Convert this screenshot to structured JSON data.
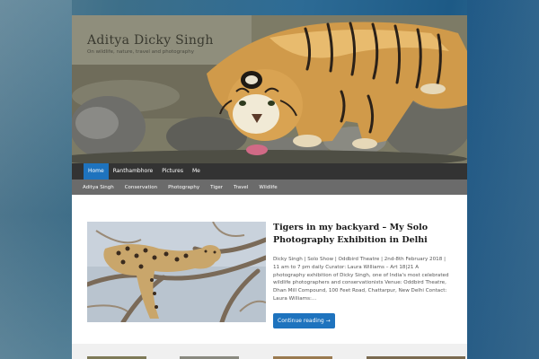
{
  "site": {
    "title": "Aditya Dicky Singh",
    "tagline": "On wildlife, nature, travel and photography"
  },
  "primary_nav": {
    "items": [
      {
        "label": "Home",
        "active": true
      },
      {
        "label": "Ranthambhore",
        "active": false
      },
      {
        "label": "Pictures",
        "active": false
      },
      {
        "label": "Me",
        "active": false
      }
    ]
  },
  "secondary_nav": {
    "items": [
      {
        "label": "Aditya Singh"
      },
      {
        "label": "Conservation"
      },
      {
        "label": "Photography"
      },
      {
        "label": "Tiger"
      },
      {
        "label": "Travel"
      },
      {
        "label": "Wildlife"
      }
    ]
  },
  "post": {
    "title": "Tigers in my backyard – My Solo Photography Exhibition in Delhi",
    "excerpt": "Dicky Singh | Solo Show | Oddbird Theatre | 2nd-8th February 2018 | 11 am to 7 pm daily Curator: Laura Williams – Art 18|21 A photography exhibition of Dicky Singh, one of India's most celebrated wildlife photographers and conservationists Venue: Oddbird Theatre, Dhan Mill Compound, 100 Feet Road, Chattarpur, New Delhi Contact: Laura Williams:…",
    "button_label": "Continue reading →"
  },
  "colors": {
    "accent": "#1e73be",
    "nav_primary": "#333333",
    "nav_secondary": "#6b6b6b"
  }
}
